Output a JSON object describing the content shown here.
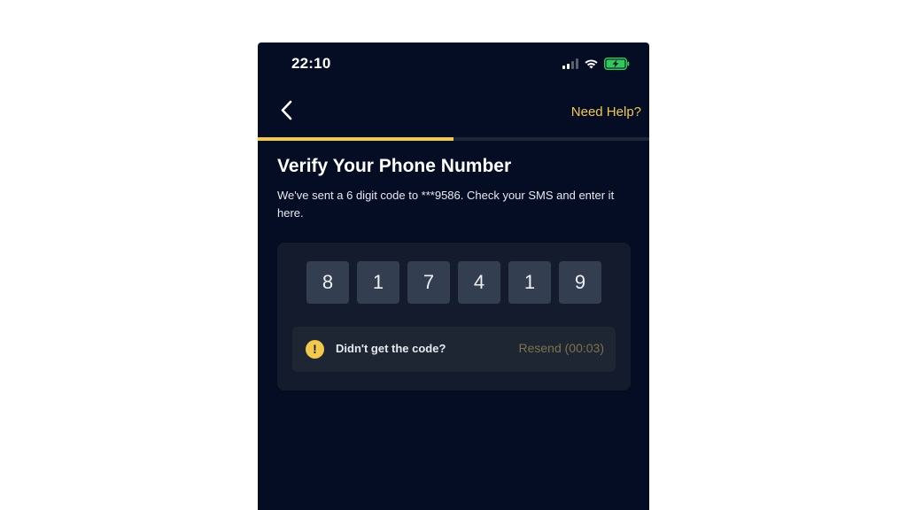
{
  "status_bar": {
    "time": "22:10",
    "icons": [
      "cellular-signal-icon",
      "wifi-icon",
      "battery-charging-icon"
    ],
    "signal_bars_active": 2,
    "signal_bars_total": 4,
    "battery_level": 0.85,
    "battery_color": "#34c759"
  },
  "nav": {
    "back_icon": "chevron-left-icon",
    "help_label": "Need Help?"
  },
  "progress": {
    "fraction": 0.5,
    "fill_color": "#f2c94c",
    "track_color": "#1f2636"
  },
  "content": {
    "title": "Verify Your Phone Number",
    "subtitle": "We've sent a 6 digit code to ***9586. Check your SMS and enter it here."
  },
  "code_entry": {
    "digits": [
      "8",
      "1",
      "7",
      "4",
      "1",
      "9"
    ]
  },
  "resend": {
    "icon": "warning-icon",
    "prompt": "Didn't get the code?",
    "button_label": "Resend (00:03)",
    "enabled": false
  },
  "colors": {
    "background": "#050d24",
    "accent": "#f2c94c",
    "card": "#141b2d",
    "digit_box": "#343e51"
  }
}
